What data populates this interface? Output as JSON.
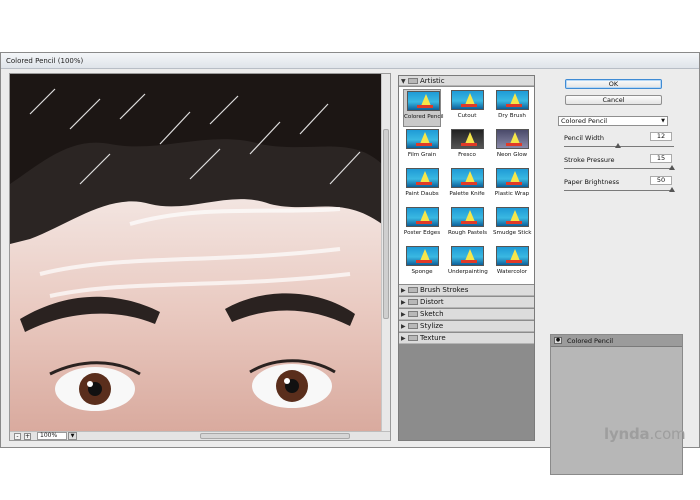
{
  "window": {
    "title": "Colored Pencil (100%)"
  },
  "preview": {
    "zoom": "100%",
    "zoom_out": "-",
    "zoom_in": "+",
    "dropdown": "▼"
  },
  "gallery": {
    "open_category": "Artistic",
    "filters": [
      {
        "label": "Colored Pencil",
        "selected": true
      },
      {
        "label": "Cutout"
      },
      {
        "label": "Dry Brush"
      },
      {
        "label": "Film Grain"
      },
      {
        "label": "Fresco"
      },
      {
        "label": "Neon Glow"
      },
      {
        "label": "Paint Daubs"
      },
      {
        "label": "Palette Knife"
      },
      {
        "label": "Plastic Wrap"
      },
      {
        "label": "Poster Edges"
      },
      {
        "label": "Rough Pastels"
      },
      {
        "label": "Smudge Stick"
      },
      {
        "label": "Sponge"
      },
      {
        "label": "Underpainting"
      },
      {
        "label": "Watercolor"
      }
    ],
    "categories": [
      "Brush Strokes",
      "Distort",
      "Sketch",
      "Stylize",
      "Texture"
    ]
  },
  "controls": {
    "ok": "OK",
    "cancel": "Cancel",
    "filter_select": "Colored Pencil",
    "params": [
      {
        "label": "Pencil Width",
        "value": "12"
      },
      {
        "label": "Stroke Pressure",
        "value": "15"
      },
      {
        "label": "Paper Brightness",
        "value": "50"
      }
    ],
    "layer": "Colored Pencil"
  },
  "watermark": {
    "brand": "lynda",
    "suffix": ".com"
  }
}
